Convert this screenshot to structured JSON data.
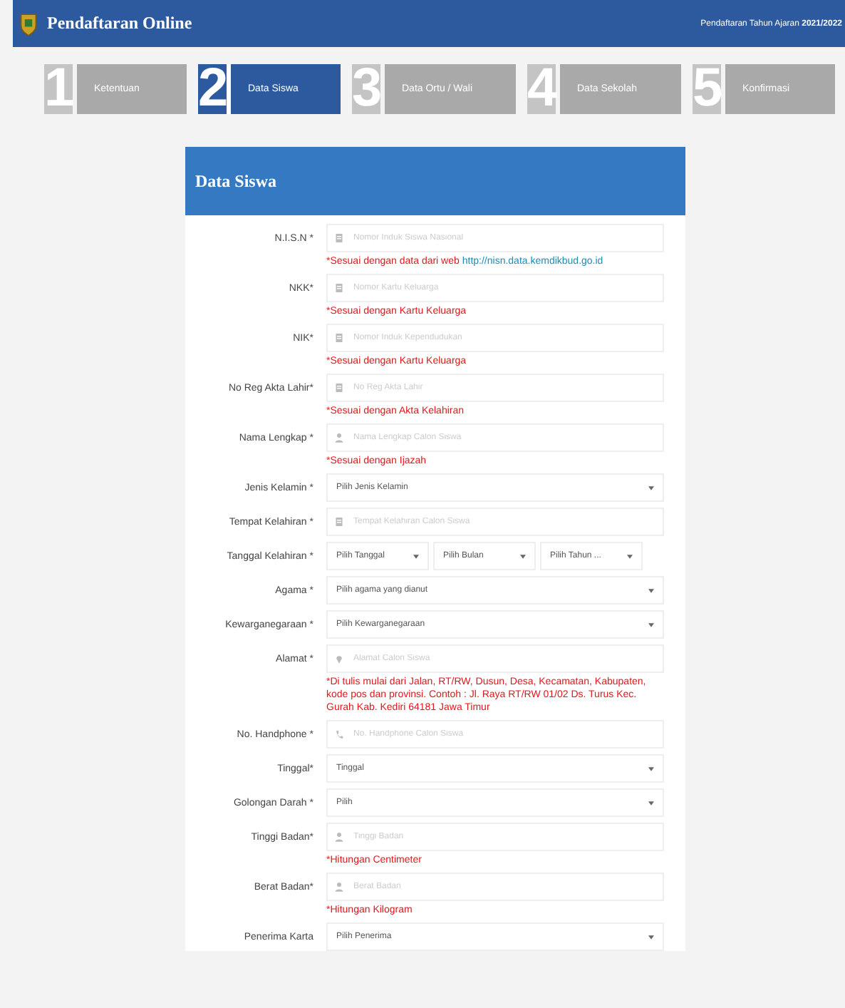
{
  "header": {
    "title": "Pendaftaran Online",
    "period": "Pendaftaran Tahun Ajaran **2021/2022**"
  },
  "steps": [
    {
      "number": "1",
      "label": "Ketentuan",
      "selected": false
    },
    {
      "number": "2",
      "label": "Data Siswa",
      "selected": true
    },
    {
      "number": "3",
      "label": "Data Ortu / Wali",
      "selected": false
    },
    {
      "number": "4",
      "label": "Data Sekolah",
      "selected": false
    },
    {
      "number": "5",
      "label": "Konfirmasi",
      "selected": false
    }
  ],
  "form": {
    "title": "Data Siswa",
    "fields": [
      {
        "label": "N.I.S.N *",
        "kind": "id-input",
        "placeholder": "Nomor Induk Siswa Nasional",
        "note": {
          "text": "*Sesuai dengan data dari web ",
          "link": "http://nisn.data.kemdikbud.go.id"
        }
      },
      {
        "label": "NKK*",
        "kind": "id-input",
        "placeholder": "Nomor Kartu Keluarga",
        "note": {
          "text": "*Sesuai dengan Kartu Keluarga"
        }
      },
      {
        "label": "NIK*",
        "kind": "id-input",
        "placeholder": "Nomor Induk Kependudukan",
        "note": {
          "text": "*Sesuai dengan Kartu Keluarga"
        }
      },
      {
        "label": "No Reg Akta Lahir*",
        "kind": "id-input",
        "placeholder": "No Reg Akta Lahir",
        "note": {
          "text": "*Sesuai dengan Akta Kelahiran"
        }
      },
      {
        "label": "Nama Lengkap *",
        "kind": "person-input",
        "placeholder": "Nama Lengkap Calon Siswa",
        "note": {
          "text": "*Sesuai dengan Ijazah"
        }
      },
      {
        "label": "Jenis Kelamin *",
        "kind": "select",
        "placeholder": "Pilih Jenis Kelamin"
      },
      {
        "label": "Tempat Kelahiran *",
        "kind": "id-input",
        "placeholder": "Tempat Kelahiran Calon Siswa"
      },
      {
        "label": "Tanggal Kelahiran *",
        "kind": "date",
        "parts": [
          "Pilih Tanggal",
          "Pilih Bulan",
          "Pilih Tahun ..."
        ]
      },
      {
        "label": "Agama *",
        "kind": "select",
        "placeholder": "Pilih agama yang dianut"
      },
      {
        "label": "Kewarganegaraan *",
        "kind": "select",
        "placeholder": "Pilih Kewarganegaraan"
      },
      {
        "label": "Alamat *",
        "kind": "address-input",
        "placeholder": "Alamat Calon Siswa",
        "note": {
          "text": "*Di tulis mulai dari Jalan, RT/RW, Dusun, Desa, Kecamatan, Kabupaten, kode pos dan provinsi. Contoh : Jl. Raya RT/RW 01/02 Ds. Turus Kec. Gurah Kab. Kediri 64181 Jawa Timur"
        }
      },
      {
        "label": "No. Handphone *",
        "kind": "phone-input",
        "placeholder": "No. Handphone Calon Siswa"
      },
      {
        "label": "Tinggal*",
        "kind": "select",
        "placeholder": "Tinggal"
      },
      {
        "label": "Golongan Darah *",
        "kind": "select",
        "placeholder": "Pilih"
      },
      {
        "label": "Tinggi Badan*",
        "kind": "person-input",
        "placeholder": "Tinggi Badan",
        "note": {
          "text": "*Hitungan Centimeter"
        }
      },
      {
        "label": "Berat Badan*",
        "kind": "person-input",
        "placeholder": "Berat Badan",
        "note": {
          "text": "*Hitungan Kilogram"
        }
      },
      {
        "label": "Penerima Karta",
        "kind": "select",
        "placeholder": "Pilih Penerima"
      }
    ]
  }
}
